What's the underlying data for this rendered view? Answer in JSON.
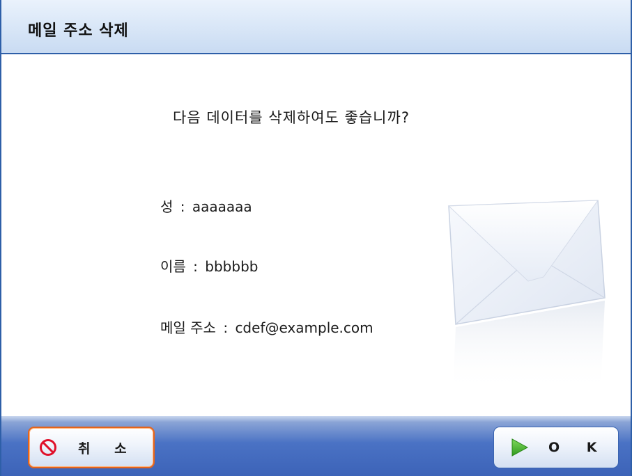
{
  "dialog": {
    "title": "메일 주소 삭제",
    "question": "다음 데이터를 삭제하여도 좋습니까?"
  },
  "fields": {
    "separator": ":",
    "surname": {
      "label": "성",
      "value": "aaaaaaa"
    },
    "given_name": {
      "label": "이름",
      "value": "bbbbbb"
    },
    "email": {
      "label": "메일 주소",
      "value": "cdef@example.com"
    }
  },
  "buttons": {
    "cancel_label": "취 소",
    "ok_label": "O K"
  },
  "icons": {
    "cancel": "prohibited-icon",
    "ok": "play-arrow-icon",
    "illustration": "envelope-icon"
  },
  "colors": {
    "frame_blue": "#2e5fa8",
    "bottom_bar_blue": "#3c63b8",
    "cancel_border": "#e5641b",
    "cancel_icon": "#e0102a",
    "ok_icon": "#3fae2a"
  }
}
